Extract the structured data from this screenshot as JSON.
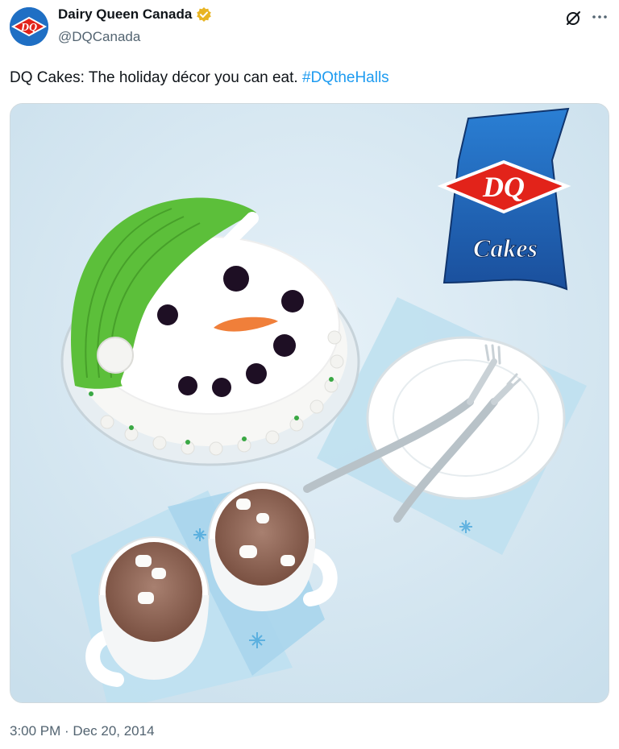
{
  "account": {
    "display_name": "Dairy Queen Canada",
    "handle": "@DQCanada",
    "avatar_text": "DQ",
    "verified_color": "#e8b423"
  },
  "tweet": {
    "text_before": "DQ Cakes: The holiday décor you can eat. ",
    "hashtag": "#DQtheHalls",
    "hashtag_color": "#1d9bf0",
    "timestamp": "3:00 PM · Dec 20, 2014"
  },
  "media": {
    "logo_main": "DQ",
    "logo_sub": "Cakes"
  },
  "icons": {
    "grok": "grok-icon",
    "more": "more-icon",
    "verified": "verified-badge-icon"
  }
}
